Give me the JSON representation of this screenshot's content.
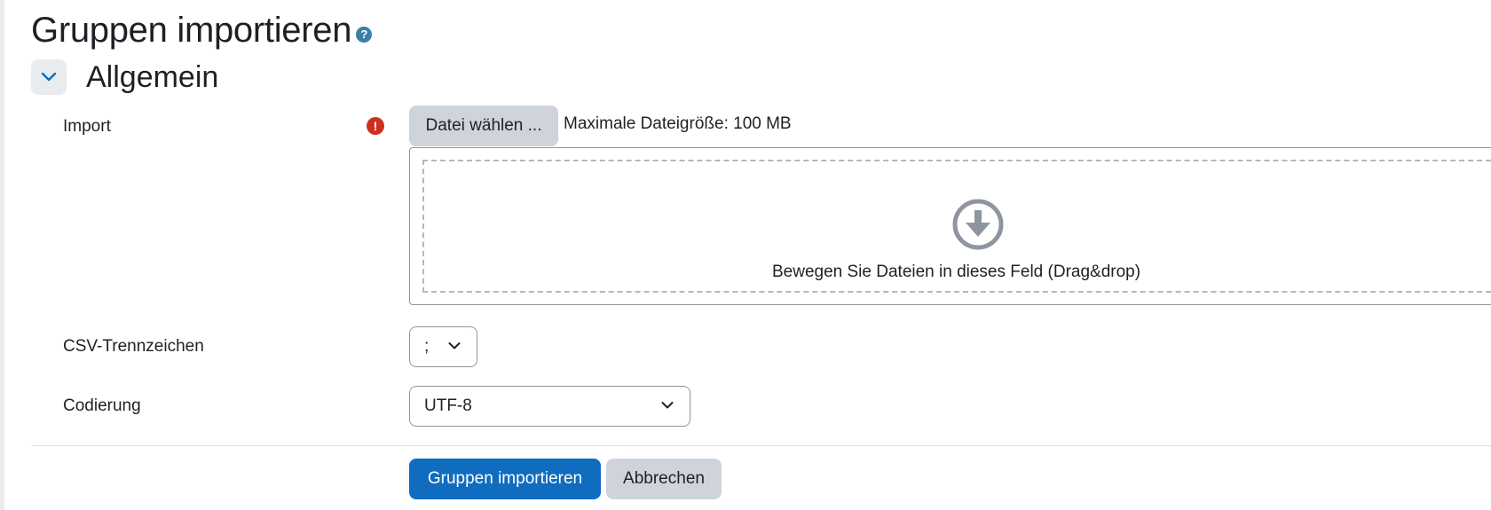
{
  "page": {
    "title": "Gruppen importieren",
    "help_icon": "question-circle-icon"
  },
  "section": {
    "title": "Allgemein",
    "toggle_icon": "chevron-down-icon"
  },
  "import_field": {
    "label": "Import",
    "required_icon": "exclamation-circle-icon",
    "choose_button": "Datei wählen ...",
    "max_size": "Maximale Dateigröße: 100 MB",
    "dropzone_text": "Bewegen Sie Dateien in dieses Feld (Drag&drop)",
    "dropzone_icon": "arrow-down-circle-icon"
  },
  "delimiter_field": {
    "label": "CSV-Trennzeichen",
    "value": ";"
  },
  "encoding_field": {
    "label": "Codierung",
    "value": "UTF-8"
  },
  "actions": {
    "submit": "Gruppen importieren",
    "cancel": "Abbrechen"
  },
  "colors": {
    "primary": "#0f6cbf",
    "secondary": "#ced4da",
    "required": "#ca3120",
    "help": "#3d7fa8"
  }
}
